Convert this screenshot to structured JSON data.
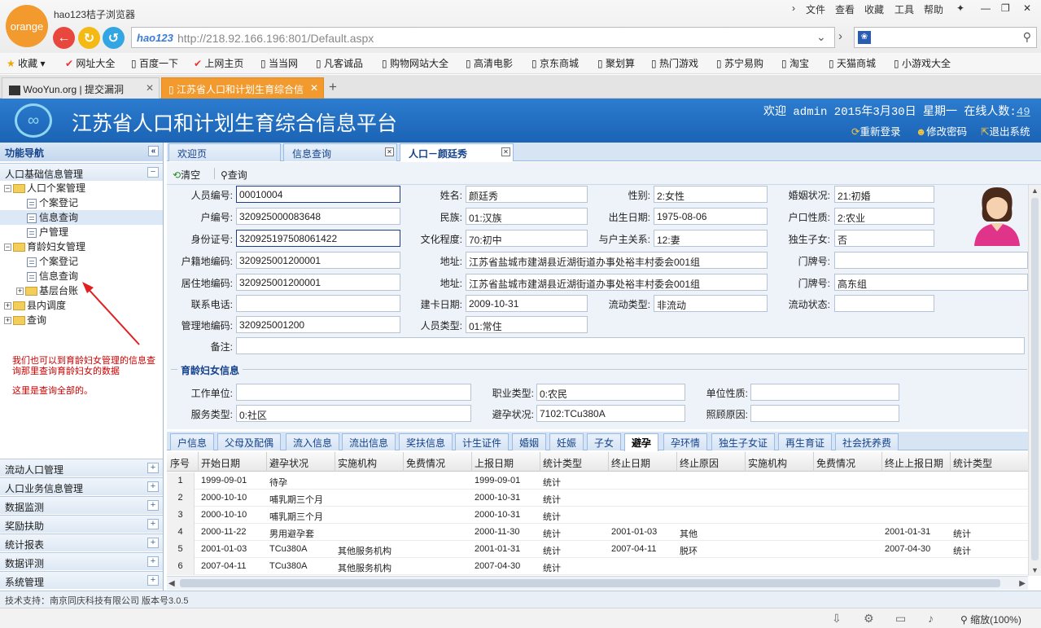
{
  "browser": {
    "logo_text": "orange",
    "title": "hao123桔子浏览器",
    "menu": [
      "文件",
      "查看",
      "收藏",
      "工具",
      "帮助"
    ],
    "address_prefix": "hao123",
    "url": "http://218.92.166.196:801/Default.aspx",
    "bookmarks": [
      "收藏",
      "网址大全",
      "百度一下",
      "上网主页",
      "当当网",
      "凡客诚品",
      "购物网站大全",
      "高清电影",
      "京东商城",
      "聚划算",
      "热门游戏",
      "苏宁易购",
      "淘宝",
      "天猫商城",
      "小游戏大全"
    ],
    "tabs": [
      "WooYun.org | 提交漏洞",
      "江苏省人口和计划生育综合信"
    ],
    "new_tab": "+",
    "zoom": "缩放(100%)"
  },
  "app": {
    "title": "江苏省人口和计划生育综合信息平台",
    "welcome": "欢迎 admin 2015年3月30日 星期一 在线人数:",
    "online_count": "49",
    "links": [
      "重新登录",
      "修改密码",
      "退出系统"
    ]
  },
  "nav": {
    "header": "功能导航",
    "section_open": "人口基础信息管理",
    "tree": [
      "人口个案管理",
      "个案登记",
      "信息查询",
      "户管理",
      "育龄妇女管理",
      "个案登记",
      "信息查询",
      "基层台账",
      "县内调度",
      "查询"
    ],
    "annotation1": "我们也可以到育龄妇女管理的信息查询那里查询育龄妇女的数据",
    "annotation2": "这里是查询全部的。",
    "sections": [
      "流动人口管理",
      "人口业务信息管理",
      "数据监测",
      "奖励扶助",
      "统计报表",
      "数据评测",
      "系统管理"
    ]
  },
  "main_tabs": [
    "欢迎页",
    "信息查询",
    "人口－颜廷秀"
  ],
  "toolbar": {
    "clear": "清空",
    "query": "查询"
  },
  "form": {
    "labels": [
      "人员编号:",
      "姓名:",
      "性别:",
      "婚姻状况:",
      "户编号:",
      "民族:",
      "出生日期:",
      "户口性质:",
      "身份证号:",
      "文化程度:",
      "与户主关系:",
      "独生子女:",
      "户籍地编码:",
      "地址:",
      "门牌号:",
      "居住地编码:",
      "地址:",
      "门牌号:",
      "联系电话:",
      "建卡日期:",
      "流动类型:",
      "流动状态:",
      "管理地编码:",
      "人员类型:",
      "备注:"
    ],
    "values": [
      "00010004",
      "颜廷秀",
      "2:女性",
      "21:初婚",
      "320925000083648",
      "01:汉族",
      "1975-08-06",
      "2:农业",
      "320925197508061422",
      "70:初中",
      "12:妻",
      "否",
      "320925001200001",
      "江苏省盐城市建湖县近湖街道办事处裕丰村委会001组",
      "",
      "320925001200001",
      "江苏省盐城市建湖县近湖街道办事处裕丰村委会001组",
      "高东组",
      "",
      "2009-10-31",
      "非流动",
      "",
      "320925001200",
      "01:常住",
      ""
    ]
  },
  "women_info": {
    "title": "育龄妇女信息",
    "labels": [
      "工作单位:",
      "职业类型:",
      "单位性质:",
      "服务类型:",
      "避孕状况:",
      "照顾原因:"
    ],
    "values": [
      "",
      "0:农民",
      "",
      "0:社区",
      "7102:TCu380A",
      ""
    ]
  },
  "sub_tabs": [
    "户信息",
    "父母及配偶",
    "流入信息",
    "流出信息",
    "奖扶信息",
    "计生证件",
    "婚姻",
    "妊娠",
    "子女",
    "避孕",
    "孕环情",
    "独生子女证",
    "再生育证",
    "社会抚养费"
  ],
  "active_sub_tab": "避孕",
  "grid": {
    "headers": [
      "序号",
      "开始日期",
      "避孕状况",
      "实施机构",
      "免费情况",
      "上报日期",
      "统计类型",
      "终止日期",
      "终止原因",
      "实施机构",
      "免费情况",
      "终止上报日期",
      "统计类型"
    ],
    "rows": [
      [
        "1",
        "1999-09-01",
        "待孕",
        "",
        "",
        "1999-09-01",
        "统计",
        "",
        "",
        "",
        "",
        "",
        ""
      ],
      [
        "2",
        "2000-10-10",
        "哺乳期三个月",
        "",
        "",
        "2000-10-31",
        "统计",
        "",
        "",
        "",
        "",
        "",
        ""
      ],
      [
        "3",
        "2000-10-10",
        "哺乳期三个月",
        "",
        "",
        "2000-10-31",
        "统计",
        "",
        "",
        "",
        "",
        "",
        ""
      ],
      [
        "4",
        "2000-11-22",
        "男用避孕套",
        "",
        "",
        "2000-11-30",
        "统计",
        "2001-01-03",
        "其他",
        "",
        "",
        "2001-01-31",
        "统计"
      ],
      [
        "5",
        "2001-01-03",
        "TCu380A",
        "其他服务机构",
        "",
        "2001-01-31",
        "统计",
        "2007-04-11",
        "脱环",
        "",
        "",
        "2007-04-30",
        "统计"
      ],
      [
        "6",
        "2007-04-11",
        "TCu380A",
        "其他服务机构",
        "",
        "2007-04-30",
        "统计",
        "",
        "",
        "",
        "",
        "",
        ""
      ]
    ]
  },
  "footer": "技术支持：南京同庆科技有限公司 版本号3.0.5"
}
